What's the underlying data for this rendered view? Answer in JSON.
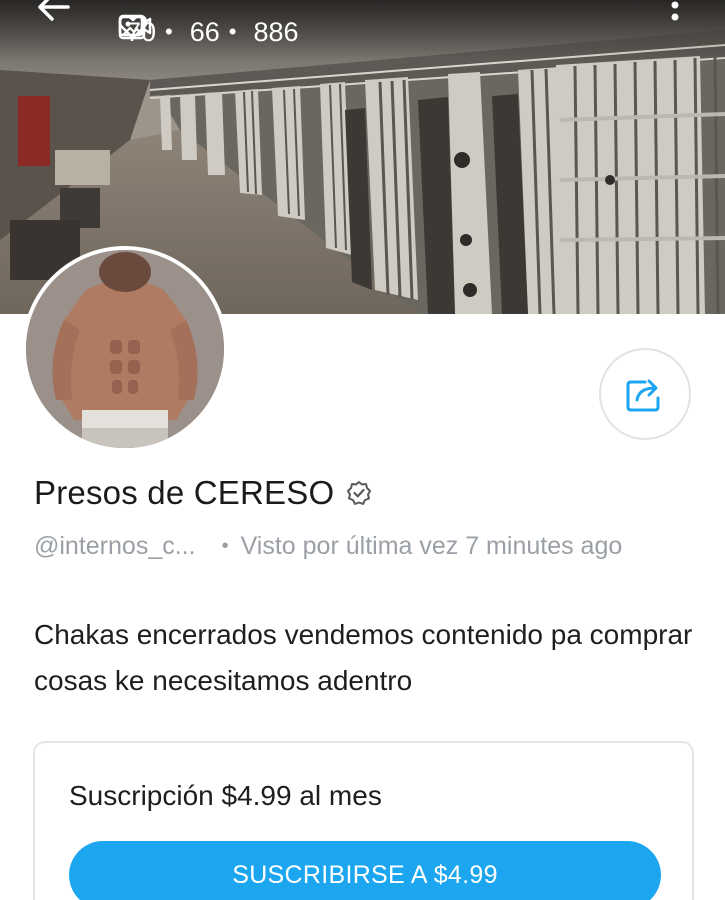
{
  "header": {
    "back_icon": "arrow-left-icon",
    "more_icon": "more-vertical-icon",
    "stats": {
      "photos": {
        "icon": "image-icon",
        "count": "70"
      },
      "videos": {
        "icon": "video-icon",
        "count": "66"
      },
      "likes": {
        "icon": "heart-icon",
        "count": "886"
      },
      "separator": "•"
    }
  },
  "profile": {
    "display_name": "Presos de CERESO",
    "verified_icon": "verified-badge-icon",
    "username": "@internos_c...",
    "separator": "•",
    "last_seen": "Visto por última vez 7 minutes ago",
    "bio": "Chakas encerrados vendemos contenido pa comprar cosas ke necesitamos adentro",
    "share_icon": "share-icon"
  },
  "subscription": {
    "title": "Suscripción $4.99 al mes",
    "button_label": "SUSCRIBIRSE A $4.99"
  },
  "colors": {
    "accent": "#1da6f0",
    "share_icon": "#1da6f0",
    "muted_text": "#9aa0a6"
  }
}
